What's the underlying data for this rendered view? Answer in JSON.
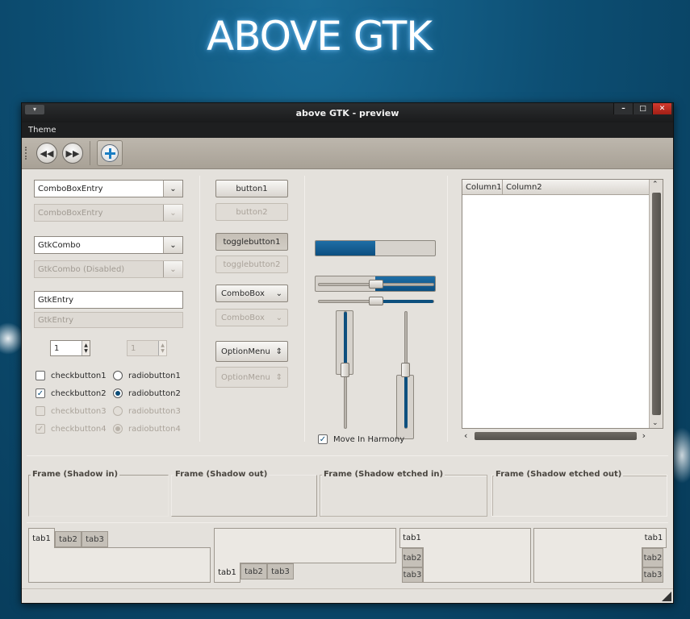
{
  "hero": {
    "title": "ABOVE GTK"
  },
  "window": {
    "title": "above GTK - preview",
    "menu_icon": "▾",
    "controls": {
      "minimize": "–",
      "maximize": "□",
      "close": "✕"
    }
  },
  "menubar": {
    "items": [
      "Theme"
    ]
  },
  "toolbar": {
    "buttons": [
      {
        "name": "rewind",
        "icon": "rewind-icon",
        "glyph": "◀◀"
      },
      {
        "name": "forward",
        "icon": "fast-forward-icon",
        "glyph": "▶▶"
      },
      {
        "name": "add",
        "icon": "add-icon"
      }
    ]
  },
  "col1": {
    "combo_entry": {
      "value": "ComboBoxEntry",
      "arrow": "⌄"
    },
    "combo_entry_disabled": {
      "value": "ComboBoxEntry"
    },
    "gtk_combo": {
      "value": "GtkCombo"
    },
    "gtk_combo_disabled": {
      "value": "GtkCombo (Disabled)"
    },
    "entry": {
      "value": "GtkEntry"
    },
    "entry_disabled": {
      "value": "GtkEntry"
    },
    "spin": {
      "value": "1",
      "up": "▲",
      "down": "▼"
    },
    "spin_disabled": {
      "value": "1"
    },
    "checks": [
      {
        "label": "checkbutton1",
        "checked": false,
        "disabled": false
      },
      {
        "label": "checkbutton2",
        "checked": true,
        "disabled": false,
        "mark": "✓"
      },
      {
        "label": "checkbutton3",
        "checked": false,
        "disabled": true
      },
      {
        "label": "checkbutton4",
        "checked": true,
        "disabled": true,
        "mark": "✓"
      }
    ],
    "radios": [
      {
        "label": "radiobutton1",
        "selected": false,
        "disabled": false
      },
      {
        "label": "radiobutton2",
        "selected": true,
        "disabled": false
      },
      {
        "label": "radiobutton3",
        "selected": false,
        "disabled": true
      },
      {
        "label": "radiobutton4",
        "selected": true,
        "disabled": true
      }
    ]
  },
  "col2": {
    "button1": "button1",
    "button2": "button2",
    "toggle1": "togglebutton1",
    "toggle2": "togglebutton2",
    "combobox": {
      "value": "ComboBox",
      "arrow": "⌄"
    },
    "combobox_disabled": {
      "value": "ComboBox"
    },
    "optionmenu": {
      "value": "OptionMenu",
      "arrow": "⇕"
    },
    "optionmenu_disabled": {
      "value": "OptionMenu"
    }
  },
  "col3": {
    "progress_h": [
      0.5,
      0.5
    ],
    "progress_v": [
      0.5,
      0.5
    ],
    "hscale": [
      0.5,
      0.5
    ],
    "vscale": [
      0.5,
      0.5
    ],
    "harmony": {
      "label": "Move In Harmony",
      "checked": true,
      "mark": "✓"
    }
  },
  "tree": {
    "columns": [
      "Column1",
      "Column2"
    ],
    "scroll_up": "⌃",
    "scroll_down": "⌄",
    "scroll_left": "‹",
    "scroll_right": "›"
  },
  "frames": [
    {
      "label": "Frame (Shadow in)"
    },
    {
      "label": "Frame (Shadow out)"
    },
    {
      "label": "Frame (Shadow etched in)"
    },
    {
      "label": "Frame (Shadow etched out)"
    }
  ],
  "notebooks": [
    {
      "position": "top",
      "tabs": [
        "tab1",
        "tab2",
        "tab3"
      ],
      "active": 0
    },
    {
      "position": "bottom",
      "tabs": [
        "tab1",
        "tab2",
        "tab3"
      ],
      "active": 0
    },
    {
      "position": "left",
      "tabs": [
        "tab1",
        "tab2",
        "tab3"
      ],
      "active": 0
    },
    {
      "position": "right",
      "tabs": [
        "tab1",
        "tab2",
        "tab3"
      ],
      "active": 0
    }
  ],
  "colors": {
    "accent": "#0d4f7e",
    "background": "#e4e1dc"
  }
}
